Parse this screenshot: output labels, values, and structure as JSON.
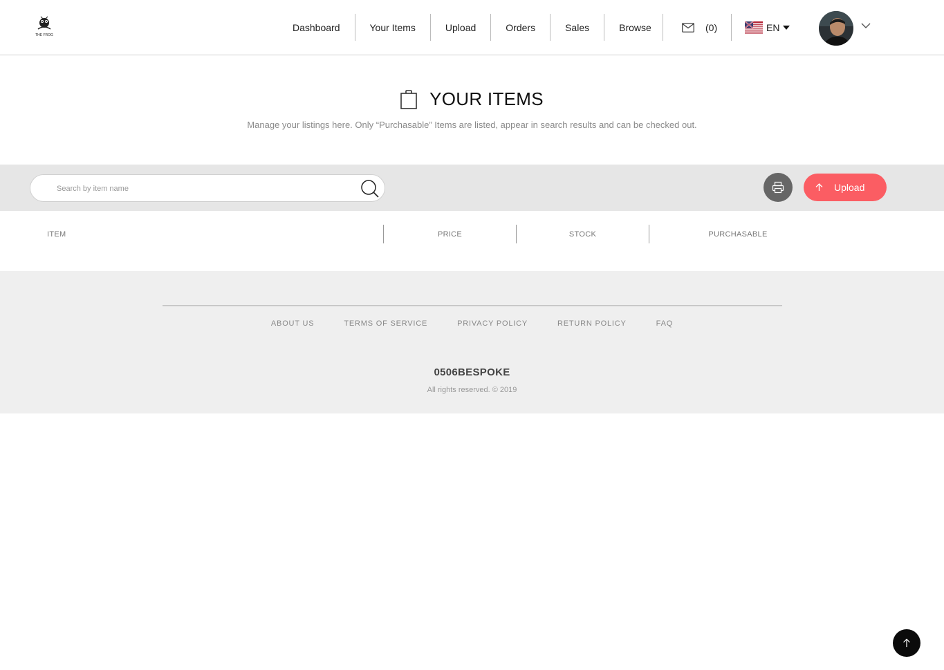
{
  "header": {
    "logo_alt": "THE FROG",
    "nav": [
      {
        "label": "Dashboard"
      },
      {
        "label": "Your Items"
      },
      {
        "label": "Upload"
      },
      {
        "label": "Orders"
      },
      {
        "label": "Sales"
      },
      {
        "label": "Browse"
      }
    ],
    "messages_count": "(0)",
    "language": "EN",
    "icons": {
      "mail": "envelope-icon",
      "flag": "us-flag-icon",
      "profile_menu": "chevron-down-icon"
    }
  },
  "hero": {
    "title": "YOUR ITEMS",
    "subtitle": "Manage your listings here. Only “Purchasable” Items are listed, appear in search results and can be checked out.",
    "icon": "shopping-bag-icon"
  },
  "toolbar": {
    "search_placeholder": "Search by item name",
    "search_value": "",
    "upload_label": "Upload",
    "icons": {
      "search": "search-icon",
      "print": "print-icon",
      "upload": "arrow-up-icon"
    }
  },
  "table": {
    "columns": [
      "ITEM",
      "PRICE",
      "STOCK",
      "PURCHASABLE"
    ],
    "rows": []
  },
  "footer": {
    "links": [
      "ABOUT US",
      "TERMS OF SERVICE",
      "PRIVACY POLICY",
      "RETURN POLICY",
      "FAQ"
    ],
    "brand": "0506BESPOKE",
    "copyright": "All rights reserved. © 2019"
  },
  "colors": {
    "accent": "#fb5d63",
    "toolbar_bg": "#e6e6e6",
    "footer_bg": "#efefef",
    "print_button": "#666666"
  }
}
